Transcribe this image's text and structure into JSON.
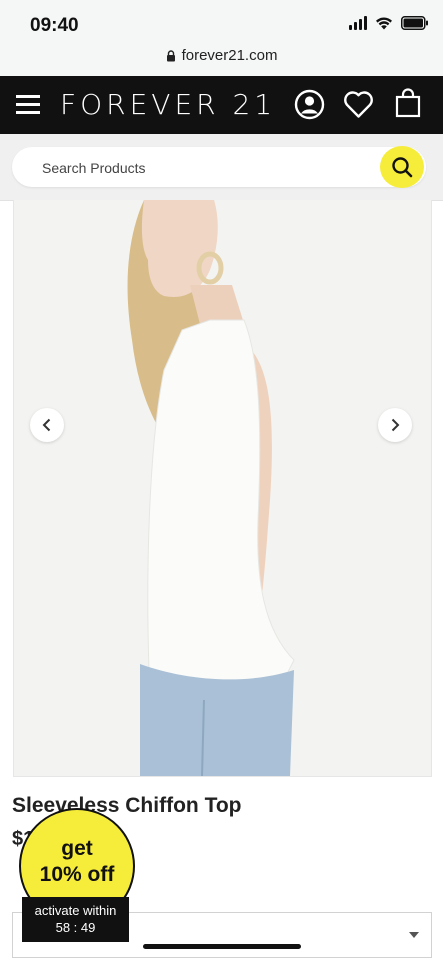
{
  "status_bar": {
    "time": "09:40"
  },
  "browser": {
    "url": "forever21.com"
  },
  "header": {
    "brand": "FOREVER 21",
    "icons": [
      "menu-icon",
      "account-icon",
      "heart-icon",
      "bag-icon"
    ]
  },
  "search": {
    "placeholder": "Search Products",
    "value": ""
  },
  "product": {
    "title": "Sleeveless Chiffon Top",
    "price_visible": "$1",
    "size_select_value": ""
  },
  "promo": {
    "line1": "get",
    "line2": "10% off",
    "timer_label": "activate within",
    "timer_value": "58 : 49"
  },
  "colors": {
    "header_bg": "#111111",
    "accent_yellow": "#f6ec3a"
  }
}
